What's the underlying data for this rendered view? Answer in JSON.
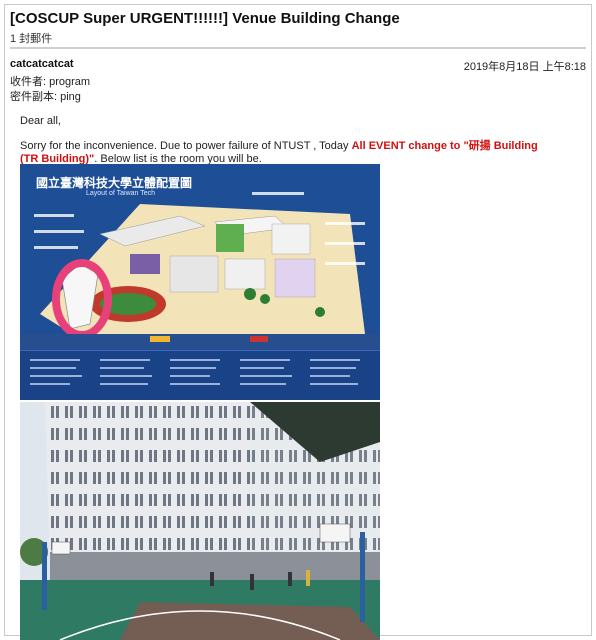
{
  "email": {
    "subject": "[COSCUP Super URGENT!!!!!!] Venue Building Change",
    "message_count": "1 封郵件",
    "sender": "catcatcatcat",
    "date": "2019年8月18日 上午8:18",
    "to_label": "收件者:",
    "to_value": "program",
    "cc_label": "密件副本:",
    "cc_value": "ping",
    "greeting": "Dear all,",
    "body_part1": "Sorry for the inconvenience. Due to power failure of NTUST , Today ",
    "body_highlight": "All EVENT change to \"研揚 Building (TR Building)\"",
    "body_part2": ".  Below list is the room you will be."
  },
  "map": {
    "title": "國立臺灣科技大學立體配置圖",
    "subtitle": "Layout of Taiwan Tech"
  },
  "colors": {
    "highlight_red": "#d01010",
    "map_blue": "#1e4e96",
    "circle_pink": "#e8417a"
  }
}
